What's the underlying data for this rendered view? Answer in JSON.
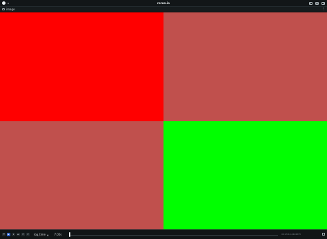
{
  "app": {
    "title": "rerun.io"
  },
  "tab": {
    "label": "image"
  },
  "image": {
    "cells": [
      {
        "name": "top-left",
        "color": "#ff0000"
      },
      {
        "name": "top-right",
        "color": "#c0504d"
      },
      {
        "name": "bottom-left",
        "color": "#c0504d"
      },
      {
        "name": "bottom-right",
        "color": "#00ff00"
      }
    ]
  },
  "timebar": {
    "controls": [
      "⏮",
      "▶",
      "⏸",
      "⏭",
      "⟳",
      "↺"
    ],
    "timeline": "log_time",
    "current_time": "7.00s",
    "end_time": "00:23:42.2444873",
    "playhead_fraction": 0.0
  },
  "icons": {
    "logo": "rerun-logo-icon",
    "menu": "chevron-down-icon",
    "panels": [
      "left-panel-icon",
      "bottom-panel-icon",
      "right-panel-icon"
    ],
    "tab": "image-view-icon",
    "more": "kebab-menu-icon",
    "fullscreen": "fullscreen-icon"
  }
}
